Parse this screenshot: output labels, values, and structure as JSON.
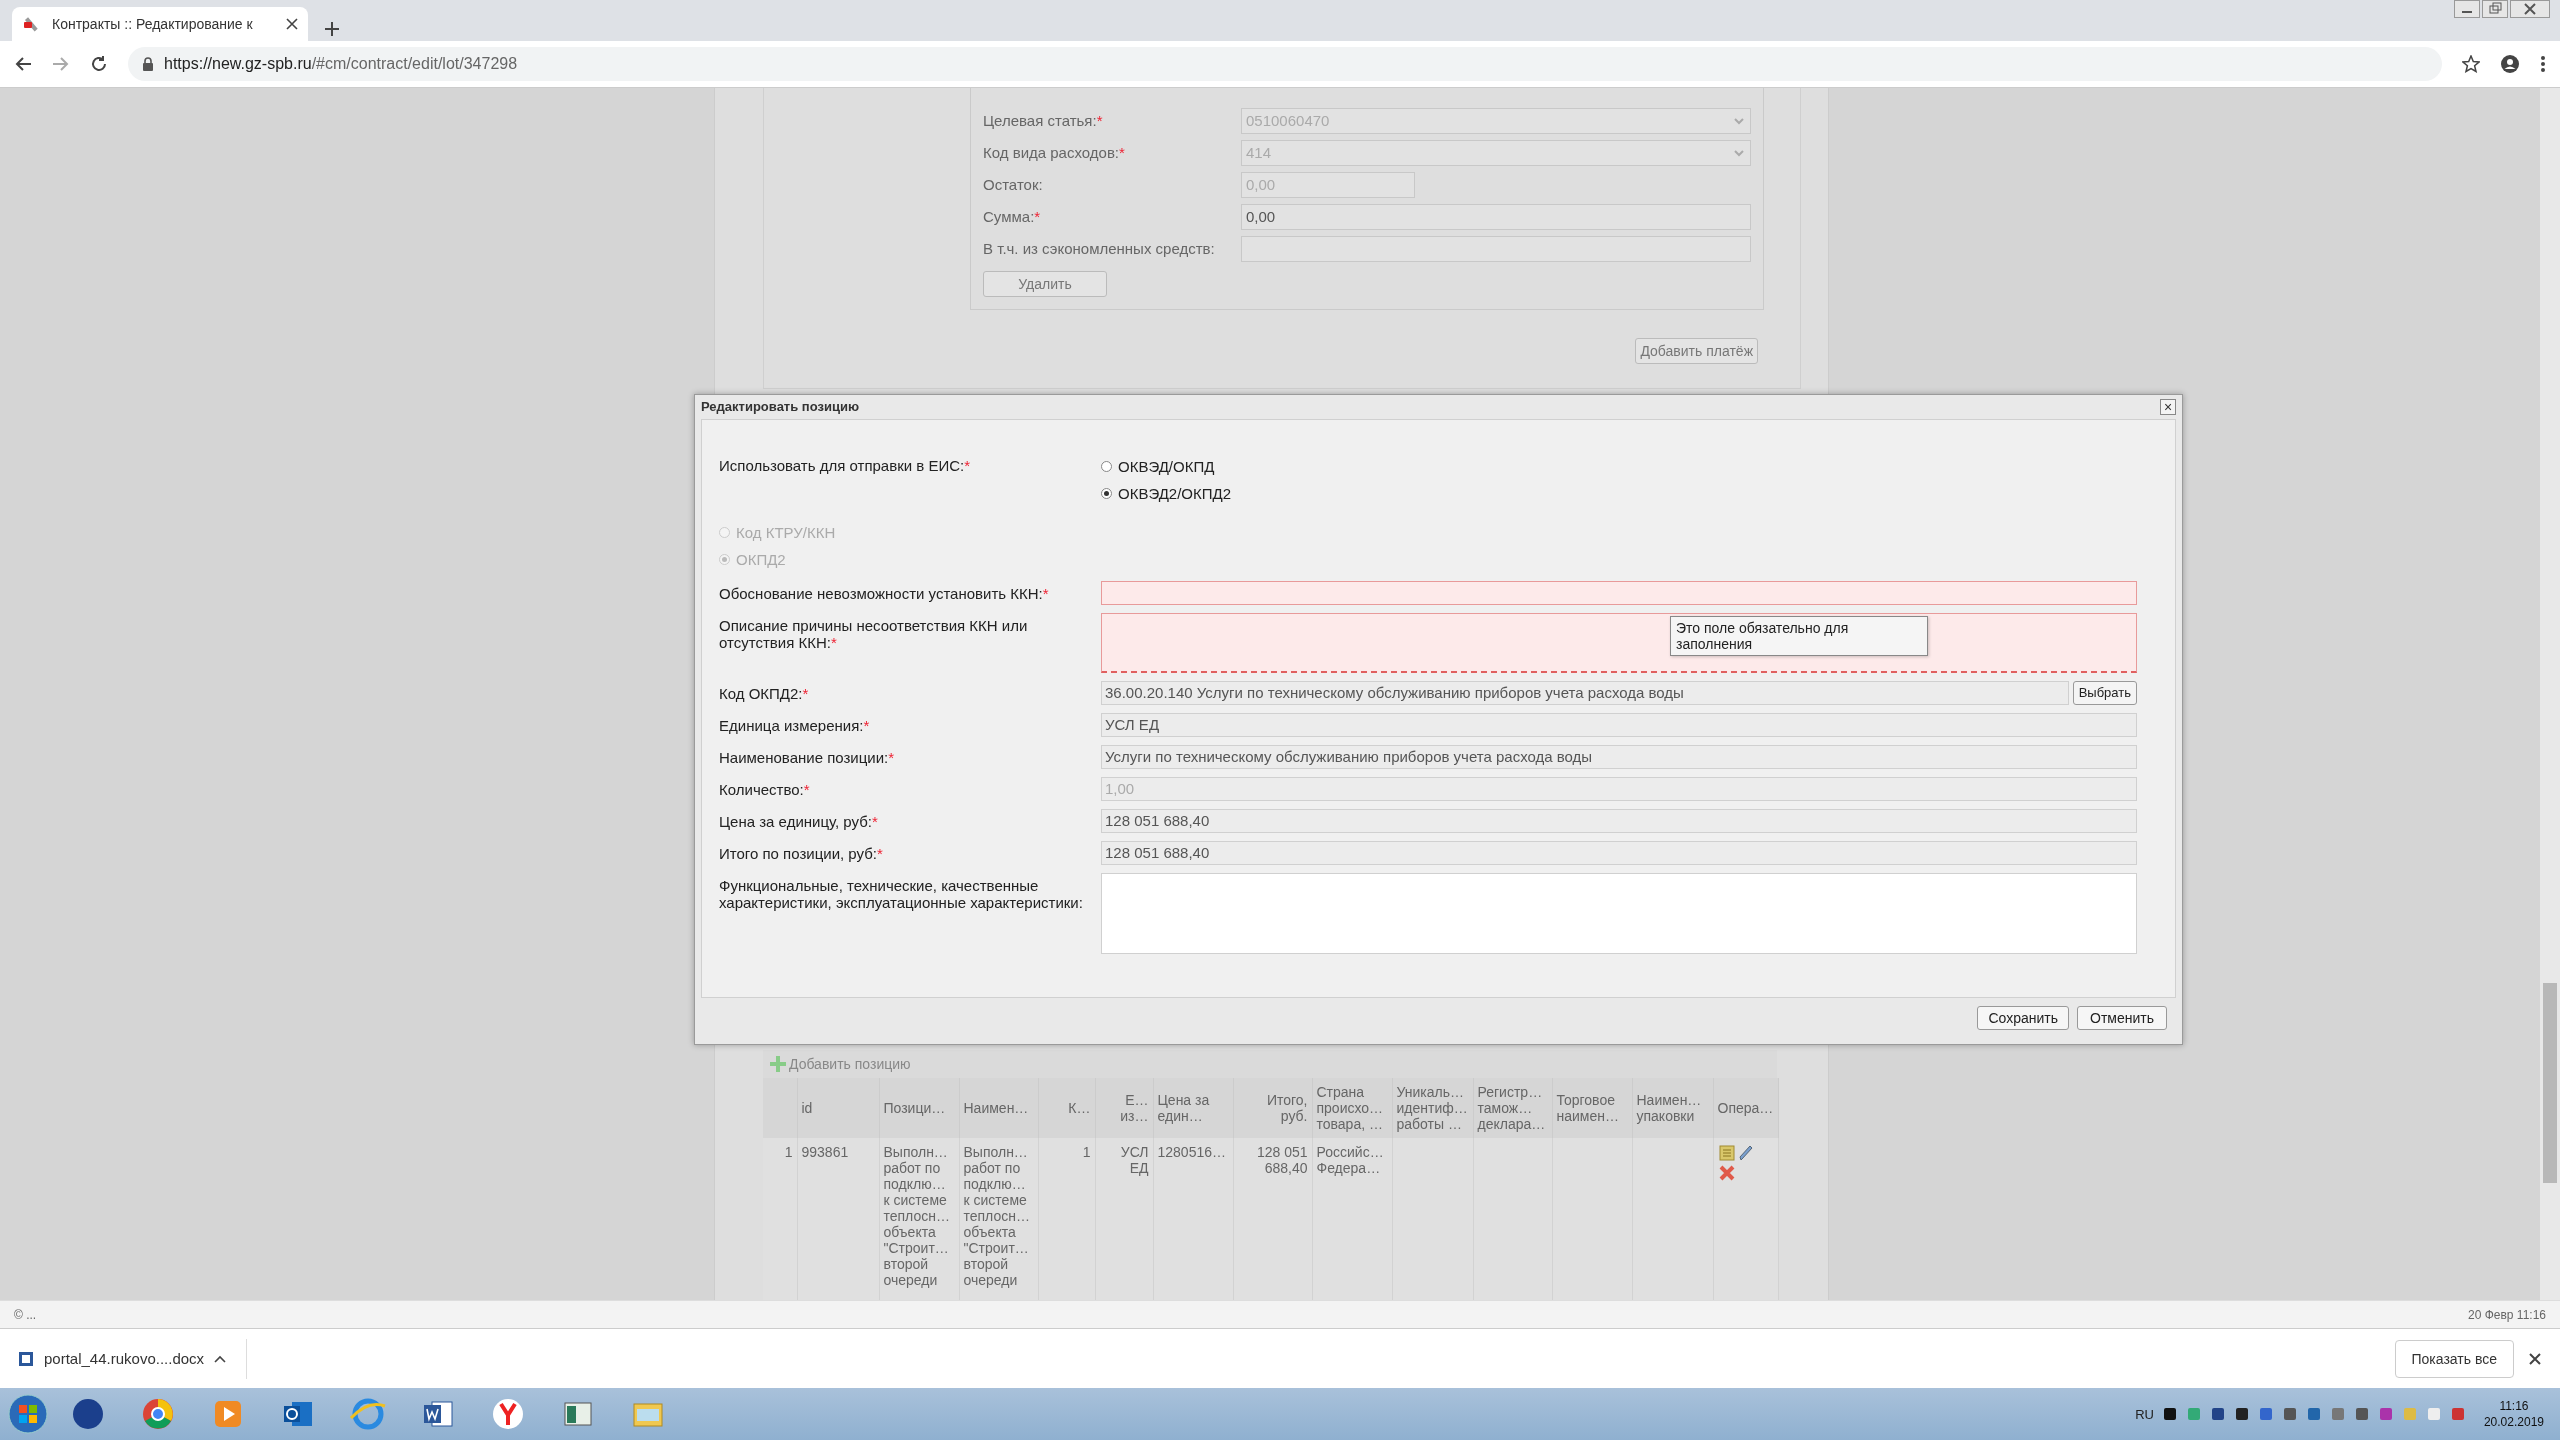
{
  "browser": {
    "tab_title": "Контракты :: Редактирование к",
    "url_host": "https://new.gz-spb.ru",
    "url_path": "/#cm/contract/edit/lot/347298"
  },
  "background_form": {
    "fields": [
      {
        "label": "Целевая статья:",
        "required_mark": "*",
        "kind": "select",
        "value": "0510060470",
        "disabled": true
      },
      {
        "label": "Код вида расходов:",
        "required_mark": "*",
        "kind": "select",
        "value": "414",
        "disabled": true
      },
      {
        "label": "Остаток:",
        "kind": "short",
        "value": "0,00",
        "disabled": true
      },
      {
        "label": "Сумма:",
        "required_mark": "*",
        "kind": "input",
        "value": "0,00",
        "disabled": false
      },
      {
        "label": "В т.ч. из сэкономленных средств:",
        "kind": "input"
      }
    ],
    "delete_button": "Удалить",
    "add_payment_button": "Добавить платёж"
  },
  "dialog": {
    "title": "Редактировать позицию",
    "close": "×",
    "send_to_eis": {
      "label": "Использовать для отправки в ЕИС:",
      "required_mark": "*",
      "options": [
        {
          "label": "ОКВЭД/ОКПД",
          "selected": false
        },
        {
          "label": "ОКВЭД2/ОКПД2",
          "selected": true
        }
      ]
    },
    "code_type": {
      "disabled": true,
      "options": [
        {
          "label": "Код КТРУ/ККН",
          "selected": false
        },
        {
          "label": "ОКПД2",
          "selected": true
        }
      ]
    },
    "fields": [
      {
        "label": "Обоснование невозможности установить ККН:",
        "required_mark": "*",
        "kind": "input",
        "invalid": true
      },
      {
        "label": "Описание причины несоответствия ККН или отсутствия ККН:",
        "required_mark": "*",
        "kind": "textarea",
        "invalid": true,
        "tooltip": "Это поле обязательно для заполнения"
      },
      {
        "label": "Код ОКПД2:",
        "required_mark": "*",
        "kind": "picker",
        "value": "36.00.20.140 Услуги по техническому обслуживанию приборов учета расхода воды",
        "button": "Выбрать",
        "invalid": false,
        "disabled": false
      },
      {
        "label": "Единица измерения:",
        "required_mark": "*",
        "kind": "input",
        "value": "УСЛ ЕД",
        "invalid": false,
        "disabled": false
      },
      {
        "label": "Наименование позиции:",
        "required_mark": "*",
        "kind": "input",
        "value": "Услуги по техническому обслуживанию приборов учета расхода воды",
        "invalid": false,
        "disabled": false
      },
      {
        "label": "Количество:",
        "required_mark": "*",
        "kind": "input",
        "value": "1,00",
        "invalid": false,
        "disabled": true
      },
      {
        "label": "Цена за единицу, руб:",
        "required_mark": "*",
        "kind": "input",
        "value": "128 051 688,40",
        "invalid": false,
        "disabled": false
      },
      {
        "label": "Итого по позиции, руб:",
        "required_mark": "*",
        "kind": "input",
        "value": "128 051 688,40",
        "invalid": false,
        "disabled": false
      },
      {
        "label": "Функциональные, технические, качественные характеристики, эксплуатационные характеристики:",
        "kind": "memo",
        "invalid": false
      }
    ],
    "buttons": [
      "Сохранить",
      "Отменить"
    ]
  },
  "table": {
    "add_label": "Добавить позицию",
    "columns": [
      "id",
      "Позици…",
      "Наимен…",
      "К…",
      "Е…\nиз…",
      "Цена за\nедин…",
      "Итого,\nруб.",
      "Страна\nпроисхо…\nтовара, …",
      "Уникаль…\nидентиф…\nработы …",
      "Регистр…\nтамож…\nдеклара…",
      "Торговое\nнаимен…",
      "Наимен…\nупаковки",
      "Опера…"
    ],
    "rows": [
      {
        "number": "1",
        "cells": [
          "993861",
          "Выполн…\nработ по\nподклю…\nк системе\nтеплосн…\nобъекта\n\"Строит…\nвторой\nочереди",
          "Выполн…\nработ по\nподклю…\nк системе\nтеплосн…\nобъекта\n\"Строит…\nвторой\nочереди",
          "1",
          "УСЛ\nЕД",
          "1280516…",
          "128 051\n688,40",
          "Российс…\nФедера…"
        ]
      }
    ]
  },
  "status_bar": {
    "left": "© ...",
    "right": "20 Февр 11:16"
  },
  "downloads": {
    "file": "portal_44.rukovo....docx",
    "show_all": "Показать все"
  },
  "taskbar": {
    "language": "RU",
    "time": "11:16",
    "date": "20.02.2019"
  }
}
